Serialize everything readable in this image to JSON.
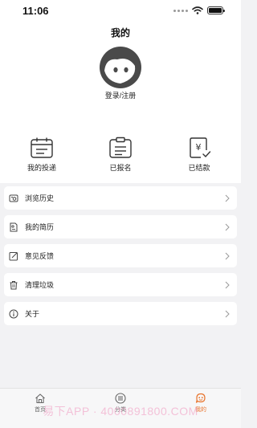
{
  "status_bar": {
    "time": "11:06"
  },
  "header": {
    "title": "我的"
  },
  "profile": {
    "login_label": "登录/注册"
  },
  "quick_actions": [
    {
      "label": "我的投递",
      "icon": "calendar-icon"
    },
    {
      "label": "已报名",
      "icon": "clipboard-icon"
    },
    {
      "label": "已结款",
      "icon": "yen-check-icon"
    }
  ],
  "menu": [
    {
      "label": "浏览历史",
      "icon": "history-icon"
    },
    {
      "label": "我的简历",
      "icon": "resume-icon"
    },
    {
      "label": "意见反馈",
      "icon": "feedback-icon"
    },
    {
      "label": "清理垃圾",
      "icon": "trash-icon"
    },
    {
      "label": "关于",
      "icon": "info-icon"
    }
  ],
  "tabs": [
    {
      "label": "首页",
      "icon": "home-icon",
      "active": false
    },
    {
      "label": "分类",
      "icon": "list-icon",
      "active": false
    },
    {
      "label": "我的",
      "icon": "user-icon",
      "active": true
    }
  ],
  "watermark": "易下APP · 4000891800.COM",
  "colors": {
    "accent": "#e8742d",
    "background": "#f2f2f4"
  }
}
